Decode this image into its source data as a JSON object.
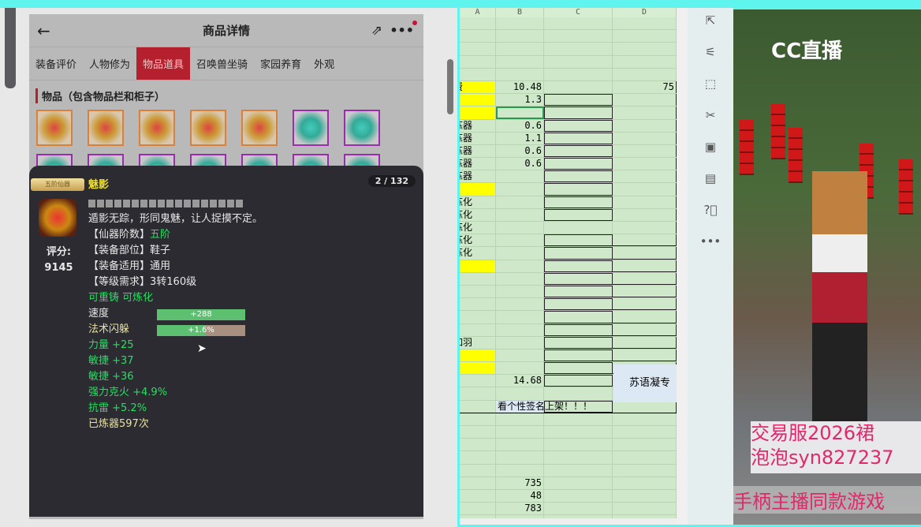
{
  "phone": {
    "title": "商品详情",
    "tabs": [
      "装备评价",
      "人物修为",
      "物品道具",
      "召唤兽坐骑",
      "家园养育",
      "外观"
    ],
    "active_tab": 2,
    "section": "物品（包含物品栏和柜子）"
  },
  "tooltip": {
    "badge": "五阶仙器",
    "name": "魅影",
    "count": "2 / 132",
    "desc": "遁影无踪，形同鬼魅，让人捉摸不定。",
    "score_label": "评分:",
    "score": "9145",
    "attrs": [
      {
        "k": "【仙器阶数】",
        "v": "五阶"
      },
      {
        "k": "【装备部位】",
        "v": "鞋子"
      },
      {
        "k": "【装备适用】",
        "v": "通用"
      },
      {
        "k": "【等级需求】",
        "v": "3转160级"
      }
    ],
    "flags": "可重铸 可炼化",
    "bars": [
      {
        "label": "速度",
        "value": "+288"
      },
      {
        "label": "法术闪躲",
        "value": "+1.6%"
      }
    ],
    "stats": [
      "力量 +25",
      "敏捷 +37",
      "敏捷 +36",
      "强力克火 +4.9%",
      "抗雷 +5.2%"
    ],
    "refine": "已炼器597次"
  },
  "sheet": {
    "columns": [
      "A",
      "B",
      "C",
      "D"
    ],
    "rows": {
      "5": {
        "A": "费",
        "B": "10.48",
        "D": "75"
      },
      "6": {
        "B": "1.3"
      },
      "8": {
        "A": "炼器",
        "B": "0.6"
      },
      "9": {
        "A": "炼器",
        "B": "1.1"
      },
      "10": {
        "A": "炼器",
        "B": "0.6"
      },
      "11": {
        "A": "炼器",
        "B": "0.6"
      },
      "12": {
        "A": "炼器"
      },
      "14": {
        "A": "炼化"
      },
      "15": {
        "A": "炼化"
      },
      "16": {
        "A": "炼化"
      },
      "17": {
        "A": "炼化"
      },
      "18": {
        "A": "炼化"
      },
      "25": {
        "A": "如羽"
      },
      "28": {
        "B": "14.68"
      },
      "30": {
        "B": "看个性签名上架！！！"
      },
      "36": {
        "B": "735"
      },
      "37": {
        "B": "48"
      },
      "38": {
        "B": "783"
      }
    },
    "yellow_rows": [
      5,
      6,
      7,
      13,
      19,
      26,
      27
    ],
    "note": "苏语凝专"
  },
  "stream": {
    "logo": "CC直播",
    "promo1": "交易服2026裙",
    "promo2": "泡泡syn827237",
    "promo3": "手柄主播同款游戏"
  }
}
